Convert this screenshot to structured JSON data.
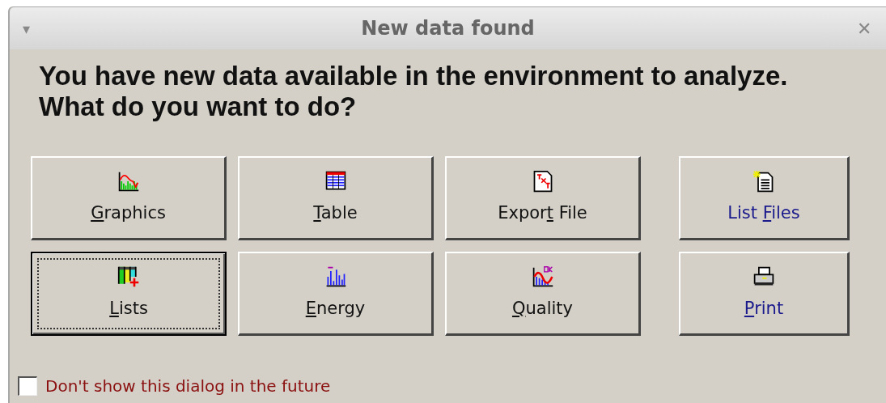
{
  "window": {
    "title": "New data found",
    "menu_glyph": "▾",
    "close_glyph": "✕"
  },
  "message": "You have new data available in the environment to analyze. What do you want to do?",
  "buttons": [
    {
      "label": {
        "key": "G",
        "after": "raphics"
      },
      "focused": false
    },
    {
      "label": {
        "key": "T",
        "after": "able"
      },
      "focused": false
    },
    {
      "label": {
        "before": "Expor",
        "key": "t",
        "after": " File"
      },
      "focused": false
    },
    {
      "label": {
        "before": "List ",
        "key": "F",
        "after": "iles"
      },
      "focused": false,
      "color": "#1a1a8c"
    },
    {
      "label": {
        "key": "L",
        "after": "ists"
      },
      "focused": true
    },
    {
      "label": {
        "key": "E",
        "after": "nergy"
      },
      "focused": false
    },
    {
      "label": {
        "key": "Q",
        "after": "uality"
      },
      "focused": false
    },
    {
      "label": {
        "key": "P",
        "after": "rint"
      },
      "focused": false,
      "color": "#1a1a8c"
    }
  ],
  "checkbox": {
    "label": "Don't show this dialog in the future",
    "checked": false
  }
}
